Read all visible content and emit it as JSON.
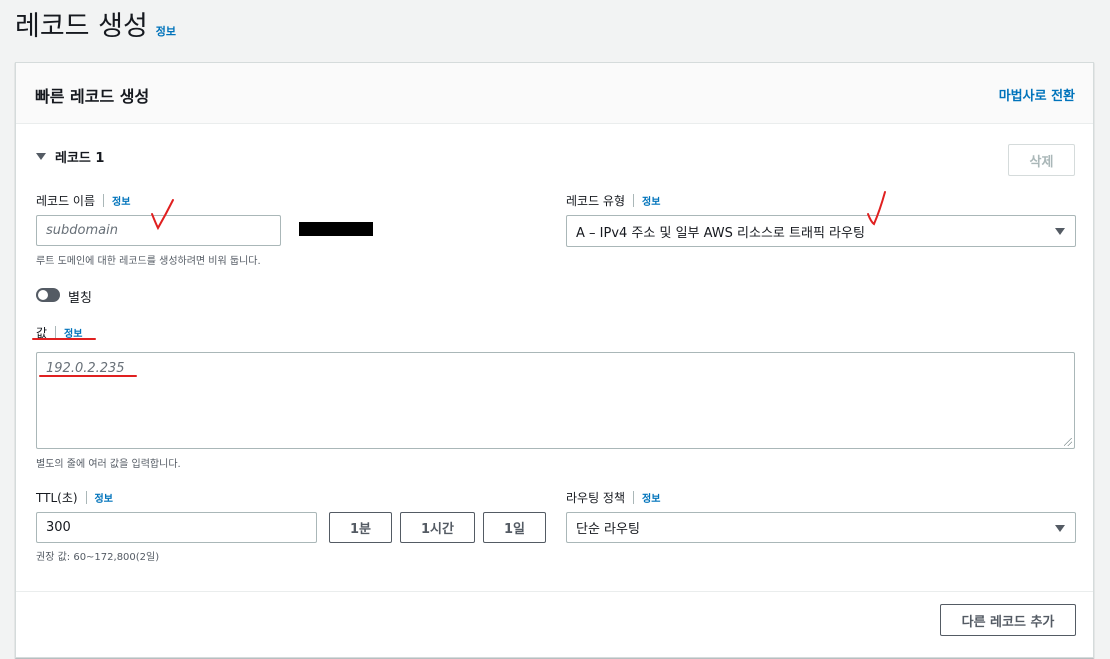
{
  "page": {
    "title": "레코드 생성",
    "info": "정보"
  },
  "panel": {
    "title": "빠른 레코드 생성",
    "wizard_link": "마법사로 전환"
  },
  "record": {
    "toggle_label": "레코드 1",
    "delete_button": "삭제",
    "name": {
      "label": "레코드 이름",
      "info": "정보",
      "placeholder": "subdomain",
      "hint": "루트 도메인에 대한 레코드를 생성하려면 비워 둡니다."
    },
    "type": {
      "label": "레코드 유형",
      "info": "정보",
      "value": "A – IPv4 주소 및 일부 AWS 리소스로 트래픽 라우팅"
    },
    "alias": {
      "label": "별칭",
      "enabled": false
    },
    "value": {
      "label": "값",
      "info": "정보",
      "placeholder": "192.0.2.235",
      "hint": "별도의 줄에 여러 값을 입력합니다."
    },
    "ttl": {
      "label": "TTL(초)",
      "info": "정보",
      "value": "300",
      "buttons": [
        "1분",
        "1시간",
        "1일"
      ],
      "hint": "권장 값: 60~172,800(2일)"
    },
    "routing": {
      "label": "라우팅 정책",
      "info": "정보",
      "value": "단순 라우팅"
    }
  },
  "footer": {
    "add_button": "다른 레코드 추가"
  },
  "colors": {
    "link": "#0073bb",
    "annotation": "#e02020",
    "redaction": "#000000"
  }
}
